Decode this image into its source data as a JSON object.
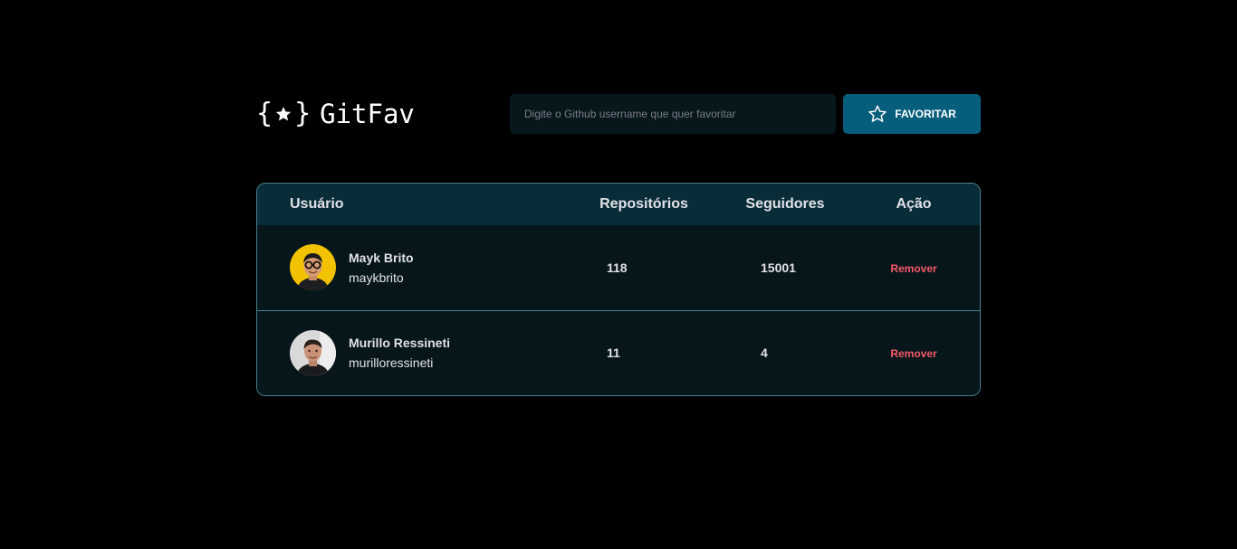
{
  "header": {
    "logo_text": "GitFav",
    "logo_icon": "star-braces-icon",
    "search_placeholder": "Digite o Github username que quer favoritar",
    "search_value": "",
    "favorite_label": "FAVORITAR",
    "favorite_icon": "star-outline-icon"
  },
  "table": {
    "columns": {
      "user": "Usuário",
      "repositories": "Repositórios",
      "followers": "Seguidores",
      "action": "Ação"
    },
    "rows": [
      {
        "name": "Mayk Brito",
        "login": "maykbrito",
        "repositories": "118",
        "followers": "15001",
        "action_label": "Remover"
      },
      {
        "name": "Murillo Ressineti",
        "login": "murilloressineti",
        "repositories": "11",
        "followers": "4",
        "action_label": "Remover"
      }
    ]
  },
  "colors": {
    "background": "#000000",
    "accent": "#065E7C",
    "table_header": "#092D38",
    "row_background": "#06161B",
    "border": "#4A808C",
    "danger": "#F75A68"
  }
}
